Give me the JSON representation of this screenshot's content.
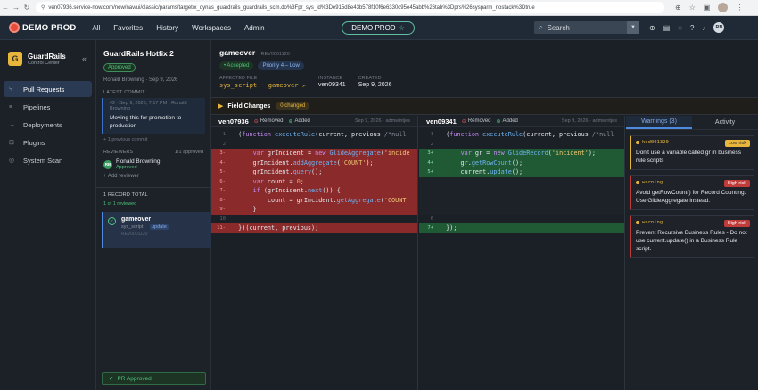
{
  "browser": {
    "url": "ven07936.service-now.com/now/nav/ui/classic/params/target/x_dynas_guardrails_guardrails_scm.do%3Fpr_sys_id%3De915d8e43b578f10f6e6330c95e45abb%26tab%3Dprs%26sysparm_nostack%3Dtrue"
  },
  "topnav": {
    "brand": "DEMO PROD",
    "menu": [
      "All",
      "Favorites",
      "History",
      "Workspaces",
      "Admin"
    ],
    "instance_badge": "DEMO PROD",
    "search_placeholder": "Search",
    "user_initials": "RB"
  },
  "sidebar": {
    "app_name": "GuardRails",
    "app_sub": "Control Center",
    "items": [
      {
        "label": "Pull Requests",
        "icon": "pull-request-icon",
        "active": true
      },
      {
        "label": "Pipelines",
        "icon": "pipeline-icon",
        "active": false
      },
      {
        "label": "Deployments",
        "icon": "deployment-icon",
        "active": false
      },
      {
        "label": "Plugins",
        "icon": "plugin-icon",
        "active": false
      },
      {
        "label": "System Scan",
        "icon": "scan-icon",
        "active": false
      }
    ]
  },
  "pr": {
    "title": "GuardRails Hotfix 2",
    "status": "Approved",
    "meta": "Ronald Browning · Sep 9, 2026",
    "latest_commit_label": "LATEST COMMIT",
    "commit_meta": "#2 · Sep 9, 2026, 7:17 PM · Ronald Browning",
    "commit_message": "Moving this for promotion to production",
    "previous_commit": "+ 1 previous commit",
    "reviewers_label": "REVIEWERS",
    "reviewers_count": "1/1 approved",
    "reviewer_initials": "RB",
    "reviewer_name": "Ronald Browning",
    "reviewer_status": "Approved",
    "add_reviewer": "+ Add reviewer",
    "records_total": "1 RECORD TOTAL",
    "reviewed": "1 of 1 reviewed",
    "record_name": "gameover",
    "record_table": "sys_script",
    "record_action": "update",
    "record_id": "REV0001120",
    "pr_approved": "PR Approved"
  },
  "record": {
    "name": "gameover",
    "number": "REV0001120",
    "accepted": "• Accepted",
    "priority": "Priority 4 – Low",
    "affected_file_label": "AFFECTED FILE",
    "affected_file": "sys_script · gameover ↗",
    "instance_label": "INSTANCE",
    "instance": "ven09341",
    "created_label": "CREATED",
    "created": "Sep 9, 2026",
    "field_changes": "Field Changes",
    "changed_count": "0 changed"
  },
  "left_pane": {
    "instance": "ven07936",
    "removed": "Removed",
    "added": "Added",
    "date": "Sep 9, 2026 · admwintjes"
  },
  "right_pane": {
    "instance": "ven09341",
    "removed": "Removed",
    "added": "Added",
    "date": "Sep 9, 2026 · admwintjes"
  },
  "warnings": {
    "tab_warnings": "Warnings (3)",
    "tab_activity": "Activity",
    "items": [
      {
        "tag": "hod001320",
        "level": "Low risk",
        "severity": "low",
        "message": "Don't use a variable called gr in business rule scripts"
      },
      {
        "tag": "warning",
        "level": "High risk",
        "severity": "high",
        "message": "Avoid getRowCount() for Record Counting. Use GlideAggregate instead."
      },
      {
        "tag": "warning",
        "level": "High risk",
        "severity": "high",
        "message": "Prevent Recursive Business Rules - Do not use current.update() in a Business Rule script."
      }
    ]
  },
  "colors": {
    "accent": "#4e8be0",
    "removed": "#8a2a2a",
    "added": "#1f5a34",
    "warning": "#e8b63a",
    "approved": "#4ec27b"
  }
}
